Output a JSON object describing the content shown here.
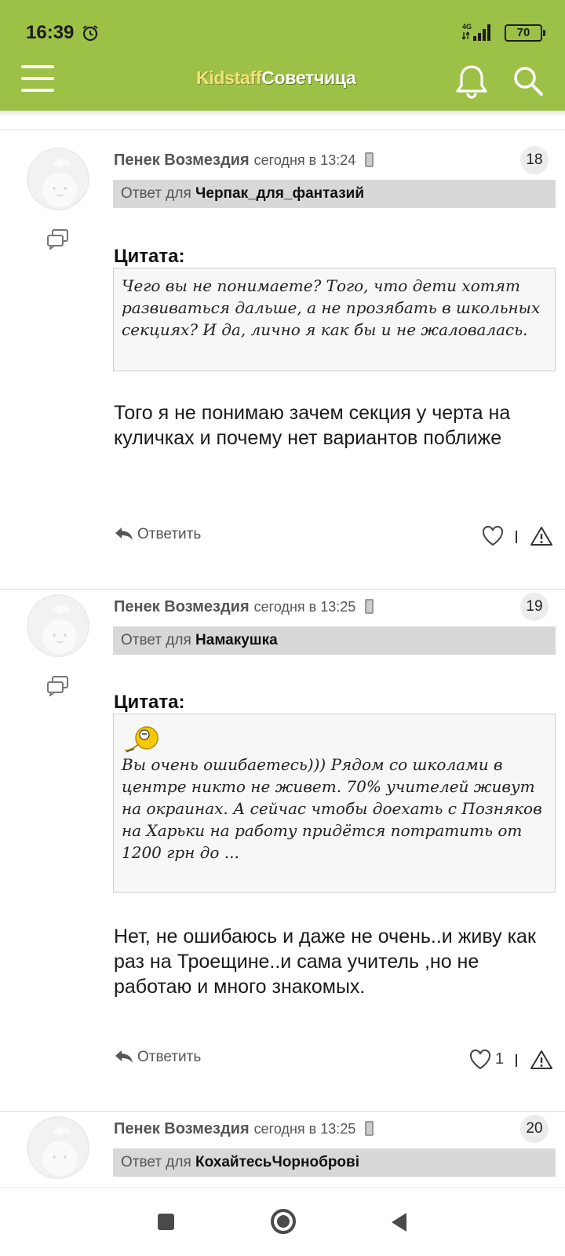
{
  "status_bar": {
    "time": "16:39",
    "network": "4G",
    "battery": "70"
  },
  "header": {
    "brand_part1": "Kidstaff",
    "brand_part2": "Советчица",
    "accent_color": "#9dc147"
  },
  "posts": [
    {
      "author": "Пенек Возмездия",
      "time": "сегодня в 13:24",
      "number": "18",
      "reply_to_prefix": "Ответ для",
      "reply_to_user": "Черпак_для_фантазий",
      "quote_label": "Цитата:",
      "quote_text": "Чего вы не понимаете? Того, что дети хотят развиваться дальше, а не прозябать в школьных секциях? И да, лично я как бы и не жаловалась.",
      "body": "Того я не понимаю зачем секция у черта на куличках и почему нет вариантов поближе",
      "reply_label": "Ответить",
      "likes": ""
    },
    {
      "author": "Пенек Возмездия",
      "time": "сегодня в 13:25",
      "number": "19",
      "reply_to_prefix": "Ответ для",
      "reply_to_user": "Намакушка",
      "quote_label": "Цитата:",
      "quote_text": "Вы очень ошибаетесь))) Рядом со школами в центре никто не живет. 70% учителей живут на окраинах. А сейчас чтобы доехать с Позняков на Харьки на работу придётся потратить от 1200 грн до ...",
      "body": "Нет, не ошибаюсь и даже не очень..и живу как раз на Троещине..и сама учитель ,но не работаю и много знакомых.",
      "reply_label": "Ответить",
      "likes": "1"
    },
    {
      "author": "Пенек Возмездия",
      "time": "сегодня в 13:25",
      "number": "20",
      "reply_to_prefix": "Ответ для",
      "reply_to_user": "КохайтесьЧорноброві"
    }
  ]
}
